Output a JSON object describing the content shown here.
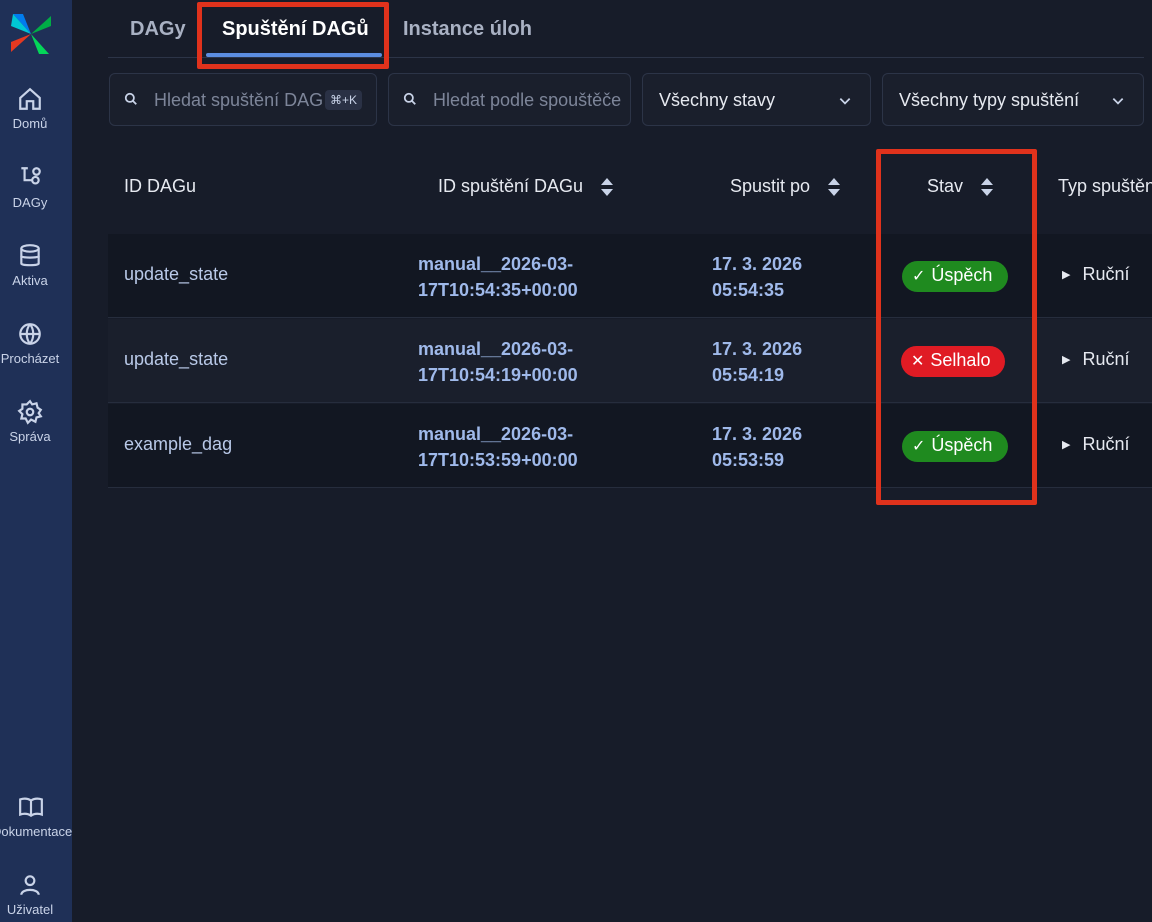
{
  "sidebar": {
    "items": [
      {
        "label": "Domů",
        "icon": "home-icon"
      },
      {
        "label": "DAGy",
        "icon": "dag-icon"
      },
      {
        "label": "Aktiva",
        "icon": "database-icon"
      },
      {
        "label": "Procházet",
        "icon": "globe-icon"
      },
      {
        "label": "Správa",
        "icon": "gear-icon"
      }
    ],
    "bottom": [
      {
        "label": "Dokumentace",
        "icon": "book-icon"
      },
      {
        "label": "Uživatel",
        "icon": "user-icon"
      }
    ]
  },
  "tabs": [
    {
      "label": "DAGy"
    },
    {
      "label": "Spuštění DAGů",
      "active": true
    },
    {
      "label": "Instance úloh"
    }
  ],
  "filters": {
    "search_runs_placeholder": "Hledat spuštění DAGů",
    "shortcut": "⌘+K",
    "search_trigger_placeholder": "Hledat podle spouštěče",
    "state_select": "Všechny stavy",
    "type_select": "Všechny typy spuštění"
  },
  "table": {
    "headers": {
      "dag_id": "ID DAGu",
      "run_id": "ID spuštění DAGu",
      "run_after": "Spustit po",
      "state": "Stav",
      "run_type": "Typ spuštění"
    },
    "rows": [
      {
        "dag_id": "update_state",
        "run_id_1": "manual__2026-03-",
        "run_id_2": "17T10:54:35+00:00",
        "date": "17. 3. 2026",
        "time": "05:54:35",
        "state": "Úspěch",
        "state_kind": "success",
        "type": "Ruční"
      },
      {
        "dag_id": "update_state",
        "run_id_1": "manual__2026-03-",
        "run_id_2": "17T10:54:19+00:00",
        "date": "17. 3. 2026",
        "time": "05:54:19",
        "state": "Selhalo",
        "state_kind": "failed",
        "type": "Ruční"
      },
      {
        "dag_id": "example_dag",
        "run_id_1": "manual__2026-03-",
        "run_id_2": "17T10:53:59+00:00",
        "date": "17. 3. 2026",
        "time": "05:53:59",
        "state": "Úspěch",
        "state_kind": "success",
        "type": "Ruční"
      }
    ]
  },
  "colors": {
    "success": "#1f8a1f",
    "failed": "#e01b24",
    "highlight": "#e0321c",
    "sidebar": "#1f3057"
  }
}
